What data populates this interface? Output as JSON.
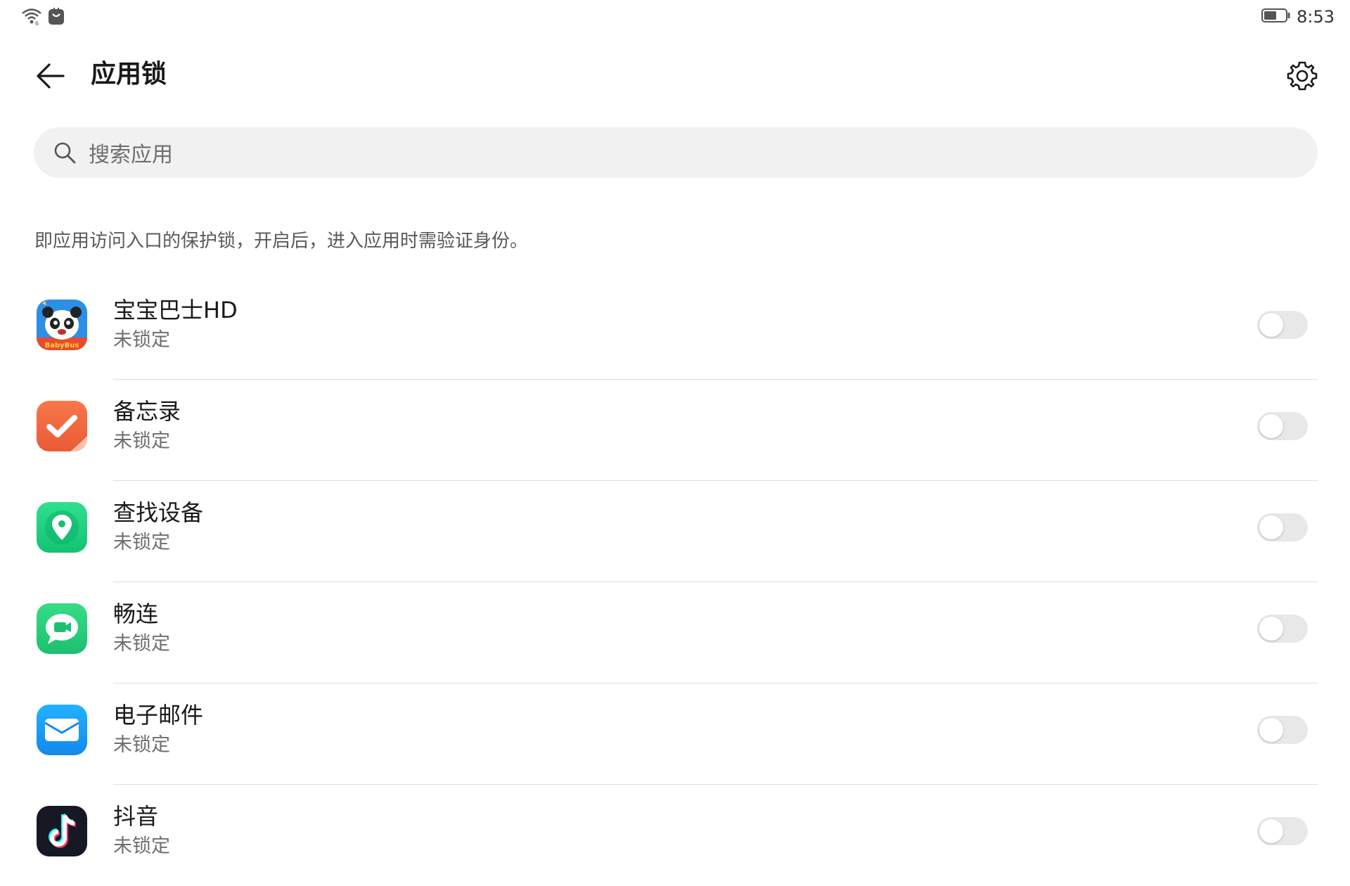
{
  "status_bar": {
    "time": "8:53",
    "icons": [
      "wifi-icon",
      "notification-icon",
      "battery-icon"
    ]
  },
  "header": {
    "title": "应用锁",
    "back_icon": "back-arrow-icon",
    "settings_icon": "gear-icon"
  },
  "search": {
    "placeholder": "搜索应用"
  },
  "description": "即应用访问入口的保护锁，开启后，进入应用时需验证身份。",
  "apps": [
    {
      "name": "宝宝巴士HD",
      "status": "未锁定",
      "icon": "babybus-icon",
      "locked": false
    },
    {
      "name": "备忘录",
      "status": "未锁定",
      "icon": "notes-icon",
      "locked": false
    },
    {
      "name": "查找设备",
      "status": "未锁定",
      "icon": "find-device-icon",
      "locked": false
    },
    {
      "name": "畅连",
      "status": "未锁定",
      "icon": "meetime-icon",
      "locked": false
    },
    {
      "name": "电子邮件",
      "status": "未锁定",
      "icon": "email-icon",
      "locked": false
    },
    {
      "name": "抖音",
      "status": "未锁定",
      "icon": "douyin-icon",
      "locked": false
    }
  ],
  "colors": {
    "toggle_off": "#e8e8e8",
    "search_bg": "#f1f1f1",
    "notes_orange": "#f06a3c",
    "find_green": "#1fcf7f",
    "meetime_green": "#2fd27c",
    "email_blue": "#1a9cf5"
  }
}
